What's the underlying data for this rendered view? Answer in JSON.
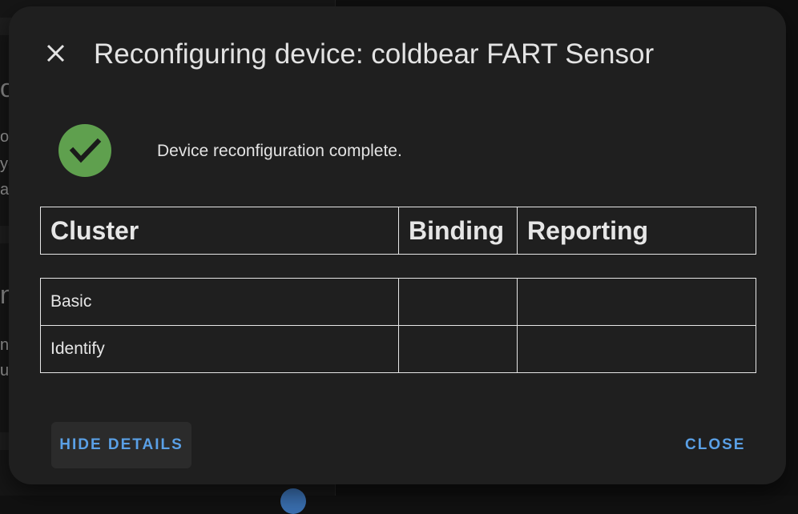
{
  "background": {
    "fragments": [
      "o",
      "or",
      "ye",
      "al",
      "n",
      "ne",
      "u"
    ]
  },
  "dialog": {
    "title": "Reconfiguring device: coldbear FART Sensor",
    "close_icon": "close-icon",
    "status_icon": "check-circle-icon",
    "status_text": "Device reconfiguration complete.",
    "table": {
      "columns": [
        "Cluster",
        "Binding",
        "Reporting"
      ],
      "rows": [
        [
          "Basic",
          "",
          ""
        ],
        [
          "Identify",
          "",
          ""
        ]
      ]
    },
    "actions": {
      "hide_details": "HIDE DETAILS",
      "close": "CLOSE"
    }
  },
  "colors": {
    "dialog_background": "#1f1f1f",
    "accent": "#5aa0e6",
    "success": "#5fa04e",
    "text": "#e3e3e3"
  }
}
